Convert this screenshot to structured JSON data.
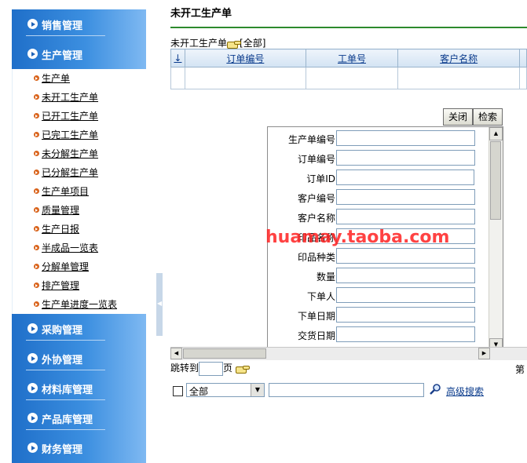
{
  "sidebar": {
    "menus": [
      {
        "label": "销售管理"
      },
      {
        "label": "生产管理"
      },
      {
        "label": "采购管理"
      },
      {
        "label": "外协管理"
      },
      {
        "label": "材料库管理"
      },
      {
        "label": "产品库管理"
      },
      {
        "label": "财务管理"
      }
    ],
    "sub_items": [
      "生产单",
      "未开工生产单",
      "已开工生产单",
      "已完工生产单",
      "未分解生产单",
      "已分解生产单",
      "生产单项目",
      "质量管理",
      "生产日报",
      "半成品一览表",
      "分解单管理",
      "排产管理",
      "生产单进度一览表"
    ]
  },
  "page": {
    "title": "未开工生产单",
    "list_caption": "未开工生产单",
    "filter_all": "[全部]"
  },
  "table": {
    "sort_glyph": "↓",
    "columns": [
      "订单编号",
      "工单号",
      "客户名称"
    ]
  },
  "buttons": {
    "close": "关闭",
    "search": "检索"
  },
  "search_panel": {
    "fields": [
      "生产单编号",
      "订单编号",
      "订单ID",
      "客户编号",
      "客户名称",
      "印品名称",
      "印品种类",
      "数量",
      "下单人",
      "下单日期",
      "交货日期"
    ]
  },
  "pager": {
    "jump_label": "跳转到",
    "page_unit": "页",
    "right_text": "第"
  },
  "bottom_search": {
    "select_value": "全部",
    "advanced": "高级搜索"
  },
  "watermark": "huamay.taoba.com",
  "colors": {
    "menu_blue": "#3c8fe0",
    "rule_green": "#2d8a2d",
    "link_blue": "#0a3b8c"
  }
}
